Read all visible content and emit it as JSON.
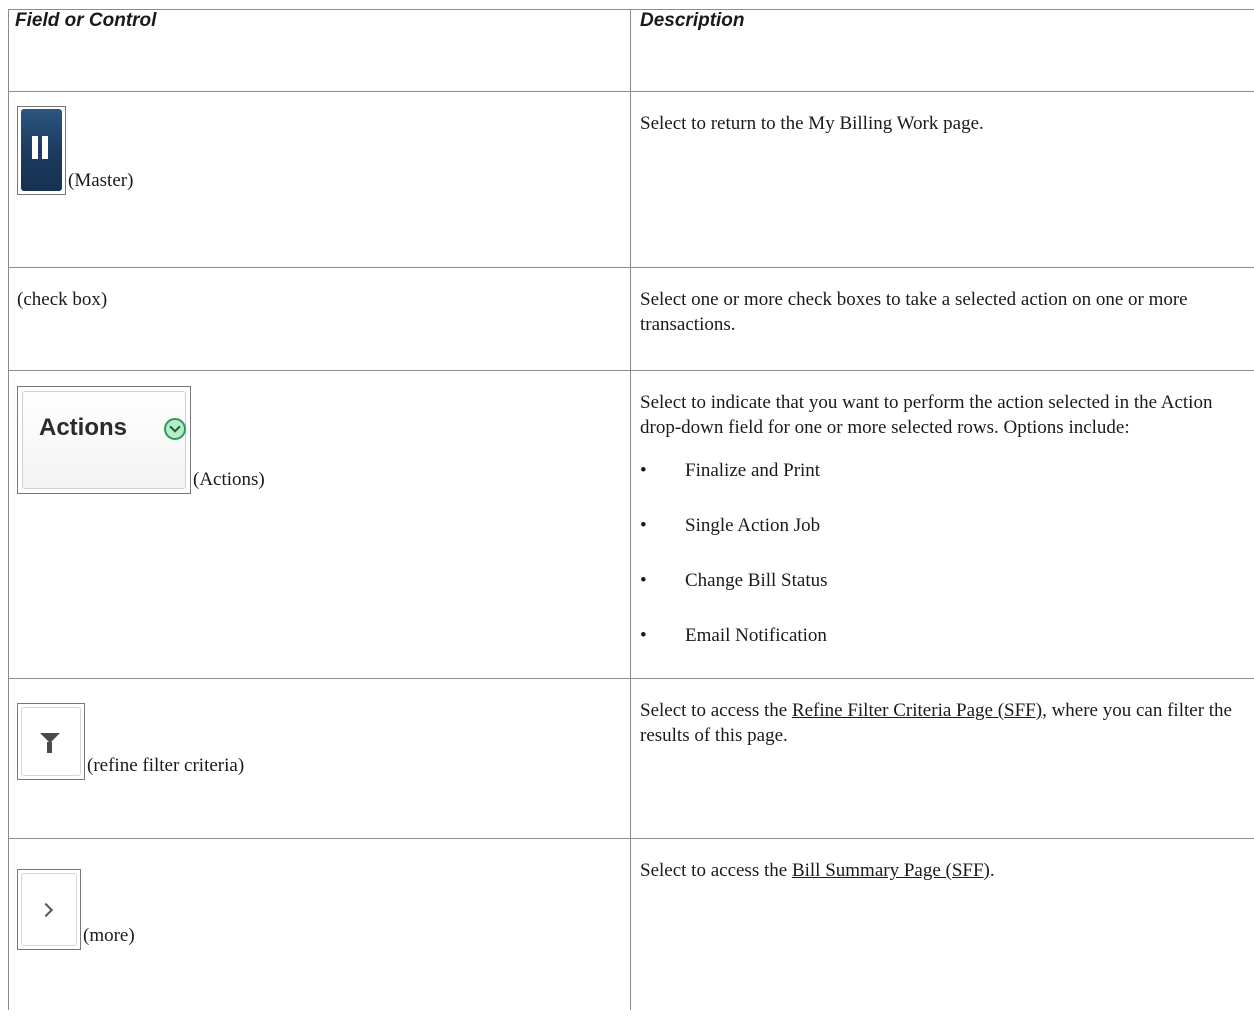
{
  "table": {
    "headers": {
      "field": "Field or Control",
      "description": "Description"
    },
    "rows": [
      {
        "icon": "pause-icon",
        "caption": "(Master)",
        "description": "Select to return to the My Billing Work page."
      },
      {
        "caption": "(check box)",
        "description": "Select one or more check boxes to take a selected action on one or more transactions."
      },
      {
        "icon": "chevron-down-circle-icon",
        "button_label": "Actions",
        "caption": "(Actions)",
        "description": "Select to indicate that you want to perform the action selected in the Action drop-down field for one or more selected rows.  Options include:",
        "options": [
          "Finalize and Print",
          "Single Action Job",
          "Change Bill Status",
          "Email Notification"
        ]
      },
      {
        "icon": "funnel-icon",
        "caption": "(refine filter criteria)",
        "description_before": "Select to access the ",
        "link": "Refine Filter Criteria Page (SFF)",
        "description_after": ", where you can filter the results of this page."
      },
      {
        "icon": "chevron-right-icon",
        "caption": "(more)",
        "description_before": "Select to access the ",
        "link": "Bill Summary Page (SFF)",
        "description_after": "."
      }
    ]
  }
}
